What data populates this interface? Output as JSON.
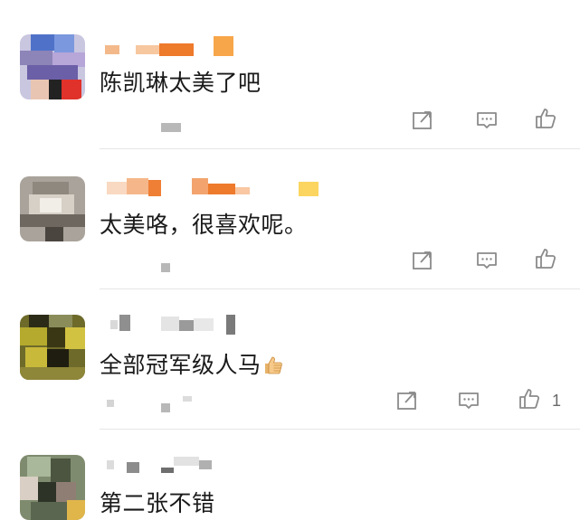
{
  "comments": [
    {
      "text": "陈凯琳太美了吧",
      "like_count": ""
    },
    {
      "text": "太美咯，很喜欢呢。",
      "like_count": ""
    },
    {
      "text": "全部冠军级人马",
      "emoji": "thumbs-up-emoji",
      "like_count": "1"
    },
    {
      "text": "第二张不错",
      "like_count": ""
    }
  ],
  "icons": {
    "repost": "repost-icon",
    "comment": "comment-icon",
    "like": "thumbs-up-icon"
  },
  "colors": {
    "text": "#1a1a1a",
    "icon": "#8a8a8a",
    "divider": "#e6e6e6"
  }
}
